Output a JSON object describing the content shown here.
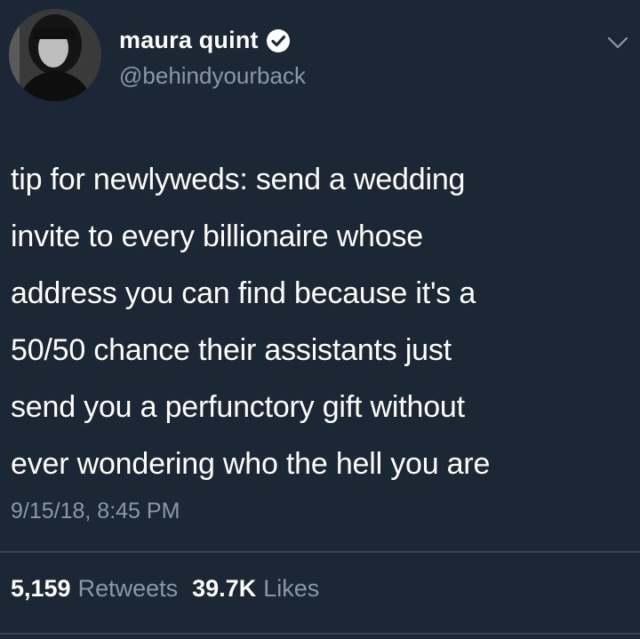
{
  "author": {
    "display_name": "maura quint",
    "handle": "@behindyourback",
    "verified": true
  },
  "icons": {
    "verified": "verified-badge-icon",
    "menu": "chevron-down-icon",
    "avatar": "profile-photo"
  },
  "tweet": {
    "lines": [
      "tip for newlyweds: send a wedding",
      "invite to every billionaire whose",
      "address you can find because it's a",
      "50/50 chance their assistants just",
      "send you a perfunctory gift without",
      "ever wondering who the hell you are"
    ],
    "timestamp": "9/15/18, 8:45 PM"
  },
  "stats": {
    "retweets_count": "5,159",
    "retweets_label": "Retweets",
    "likes_count": "39.7K",
    "likes_label": "Likes"
  },
  "colors": {
    "background": "#1b2734",
    "secondary_text": "#8899a6",
    "divider": "#38444d"
  }
}
